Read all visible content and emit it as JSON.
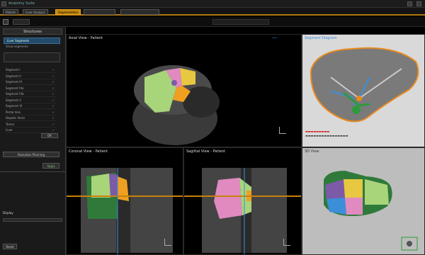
{
  "window": {
    "title": "Anatomy Suite"
  },
  "tabs": [
    {
      "label": "Patient"
    },
    {
      "label": "Liver Analysis"
    },
    {
      "label": "Segmentation"
    }
  ],
  "left_panel": {
    "header": "Structures",
    "group_label": "Liver Segments",
    "sub_label": "Show segments",
    "structures": [
      {
        "name": "Segment I"
      },
      {
        "name": "Segment II"
      },
      {
        "name": "Segment III"
      },
      {
        "name": "Segment IVa"
      },
      {
        "name": "Segment IVb"
      },
      {
        "name": "Segment V"
      },
      {
        "name": "Segment VI"
      },
      {
        "name": "Portal Vein"
      },
      {
        "name": "Hepatic Veins"
      },
      {
        "name": "Tumor"
      },
      {
        "name": "Liver"
      }
    ],
    "ok_button": "OK",
    "action_button": "Resection Planning",
    "apply_button": "Apply",
    "lower_header": "Display",
    "lower_button": "Reset"
  },
  "viewports": {
    "axial": {
      "title": "Axial View - Patient"
    },
    "coronal": {
      "title": "Coronal View - Patient"
    },
    "sagittal": {
      "title": "Sagittal View - Patient"
    },
    "schematic": {
      "title": "Segment Diagram"
    },
    "render3d": {
      "title": "3D View"
    }
  },
  "colors": {
    "accent": "#c58a10",
    "seg_green": "#a8d47a",
    "seg_pink": "#e08ac0",
    "seg_purple": "#7c5aa8",
    "seg_yellow": "#e8c840",
    "seg_orange": "#f0a020",
    "seg_darkgreen": "#2f7a3a",
    "seg_blue": "#3b8fd9",
    "crosshair": "#c8820c"
  }
}
